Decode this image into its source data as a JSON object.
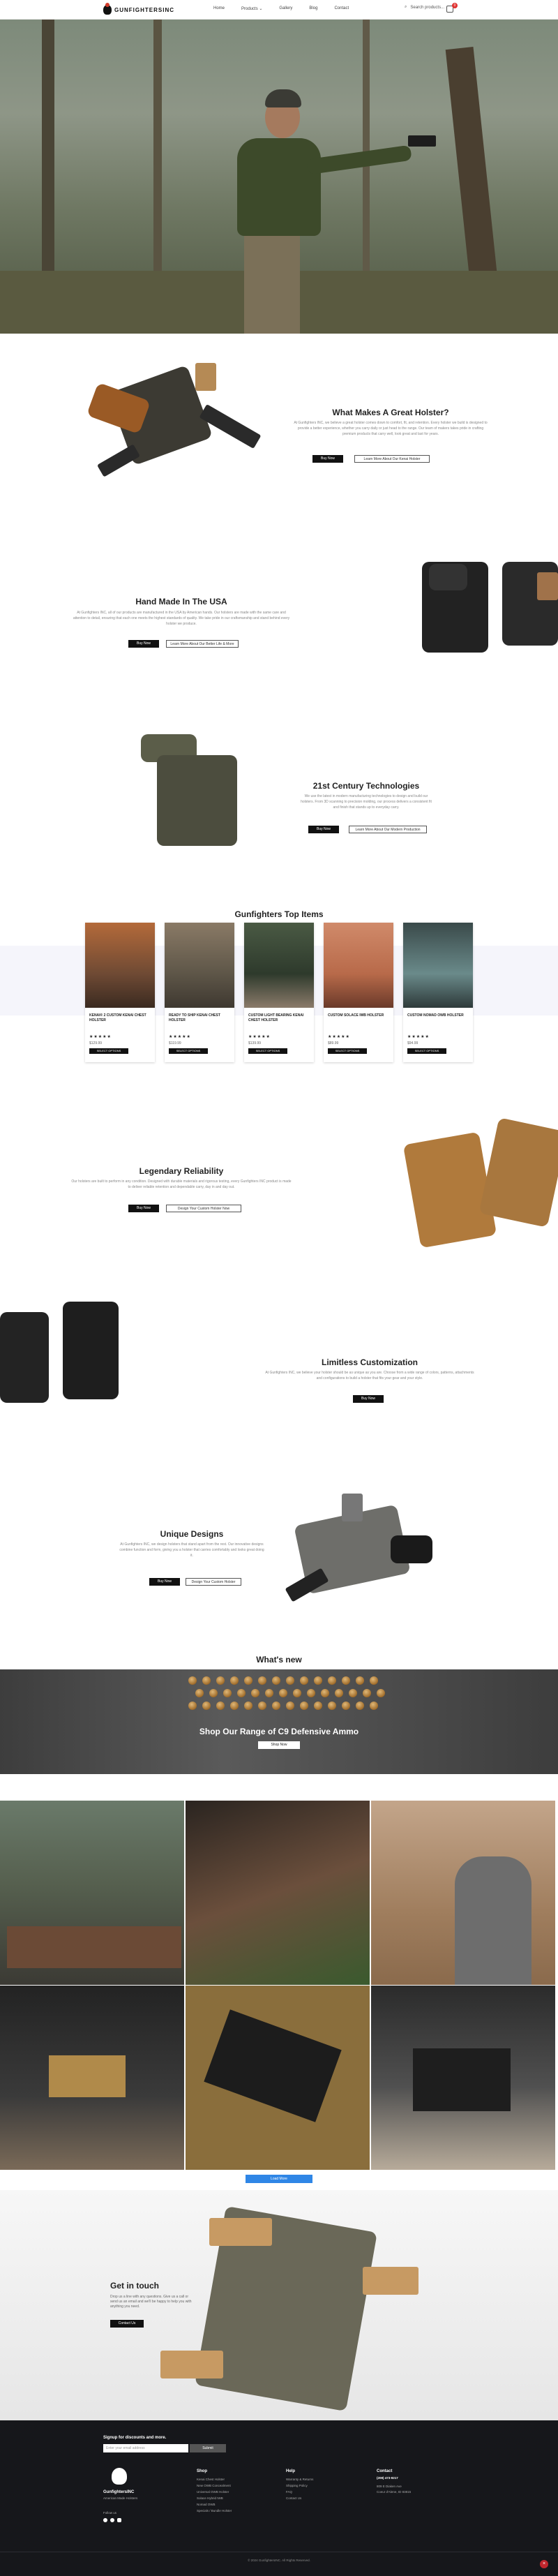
{
  "header": {
    "logo_text": "GUNFIGHTERSINC",
    "nav": [
      "Home",
      "Products",
      "Gallery",
      "Blog",
      "Contact"
    ],
    "search_placeholder": "Search products...",
    "cart_count": "0"
  },
  "sections": {
    "great_holster": {
      "title": "What Makes A Great Holster?",
      "text": "At Gunfighters INC, we believe a great holster comes down to comfort, fit, and retention. Every holster we build is designed to provide a better experience, whether you carry daily or just head to the range. Our team of makers takes pride in crafting premium products that carry well, look great and last for years.",
      "btn_primary": "Buy Now",
      "btn_secondary": "Learn More About Our Kenai Holster"
    },
    "made_usa": {
      "title": "Hand Made In The USA",
      "text": "At Gunfighters INC, all of our products are manufactured in the USA by American hands. Our holsters are made with the same care and attention to detail, ensuring that each one meets the highest standards of quality. We take pride in our craftsmanship and stand behind every holster we produce.",
      "btn_primary": "Buy Now",
      "btn_secondary": "Learn More About Our Better Life & More"
    },
    "technologies": {
      "title": "21st Century Technologies",
      "text": "We use the latest in modern manufacturing technologies to design and build our holsters. From 3D scanning to precision molding, our process delivers a consistent fit and finish that stands up to everyday carry.",
      "btn_primary": "Buy Now",
      "btn_secondary": "Learn More About Our Modern Production"
    },
    "top_items": {
      "title": "Gunfighters Top Items"
    },
    "reliability": {
      "title": "Legendary Reliability",
      "text": "Our holsters are built to perform in any condition. Designed with durable materials and rigorous testing, every Gunfighters INC product is made to deliver reliable retention and dependable carry, day in and day out.",
      "btn_primary": "Buy Now",
      "btn_secondary": "Design Your Custom Holster Now"
    },
    "customization": {
      "title": "Limitless Customization",
      "text": "At Gunfighters INC, we believe your holster should be as unique as you are. Choose from a wide range of colors, patterns, attachments and configurations to build a holster that fits your gear and your style.",
      "btn_primary": "Buy Now"
    },
    "unique_designs": {
      "title": "Unique Designs",
      "text": "At Gunfighters INC, we design holsters that stand apart from the rest. Our innovative designs combine function and form, giving you a holster that carries comfortably and looks great doing it.",
      "btn_primary": "Buy Now",
      "btn_secondary": "Design Your Custom Holster"
    },
    "whats_new": {
      "title": "What's new"
    },
    "ammo": {
      "title": "Shop Our Range of C9 Defensive Ammo",
      "btn": "Shop Now"
    },
    "gallery": {
      "load_more": "Load More"
    },
    "contact": {
      "title": "Get in touch",
      "text": "Drop us a line with any questions. Give us a call or send us an email and we'll be happy to help you with anything you need.",
      "btn": "Contact Us"
    }
  },
  "products": [
    {
      "title": "KENAI® 2 CUSTOM KENAI CHEST HOLSTER",
      "stars": "★★★★★",
      "price": "$129.99",
      "btn": "SELECT OPTIONS"
    },
    {
      "title": "READY TO SHIP KENAI CHEST HOLSTER",
      "stars": "★★★★★",
      "price": "$119.99",
      "btn": "SELECT OPTIONS"
    },
    {
      "title": "CUSTOM LIGHT BEARING KENAI CHEST HOLSTER",
      "stars": "★★★★★",
      "price": "$139.99",
      "btn": "SELECT OPTIONS"
    },
    {
      "title": "CUSTOM SOLACE IWB HOLSTER",
      "stars": "★★★★★",
      "price": "$89.99",
      "btn": "SELECT OPTIONS"
    },
    {
      "title": "CUSTOM NOMAD OWB HOLSTER",
      "stars": "★★★★★",
      "price": "$94.99",
      "btn": "SELECT OPTIONS"
    }
  ],
  "footer": {
    "signup_title": "Signup for discounts and more.",
    "email_placeholder": "Enter your email address",
    "signup_btn": "Submit",
    "brand": "GunfightersINC",
    "brand_sub": "American Made Holsters",
    "follow": "Follow us",
    "shop_title": "Shop",
    "shop_links": [
      "Kenai Chest Holster",
      "New OWB Concealment",
      "Universal OWB Holster",
      "Solace Hybrid IWB",
      "Nomad OWB",
      "Specials / Bundle Holster"
    ],
    "help_title": "Help",
    "help_links": [
      "Warranty & Returns",
      "Shipping Policy",
      "FAQ",
      "Contact Us"
    ],
    "contact_title": "Contact",
    "phone": "(208) 473-9217",
    "address_1": "809 E Diaken Ave",
    "address_2": "Coeur d'Alene, ID 83815",
    "copyright": "© 2024 GunfightersINC. All Rights Reserved."
  }
}
